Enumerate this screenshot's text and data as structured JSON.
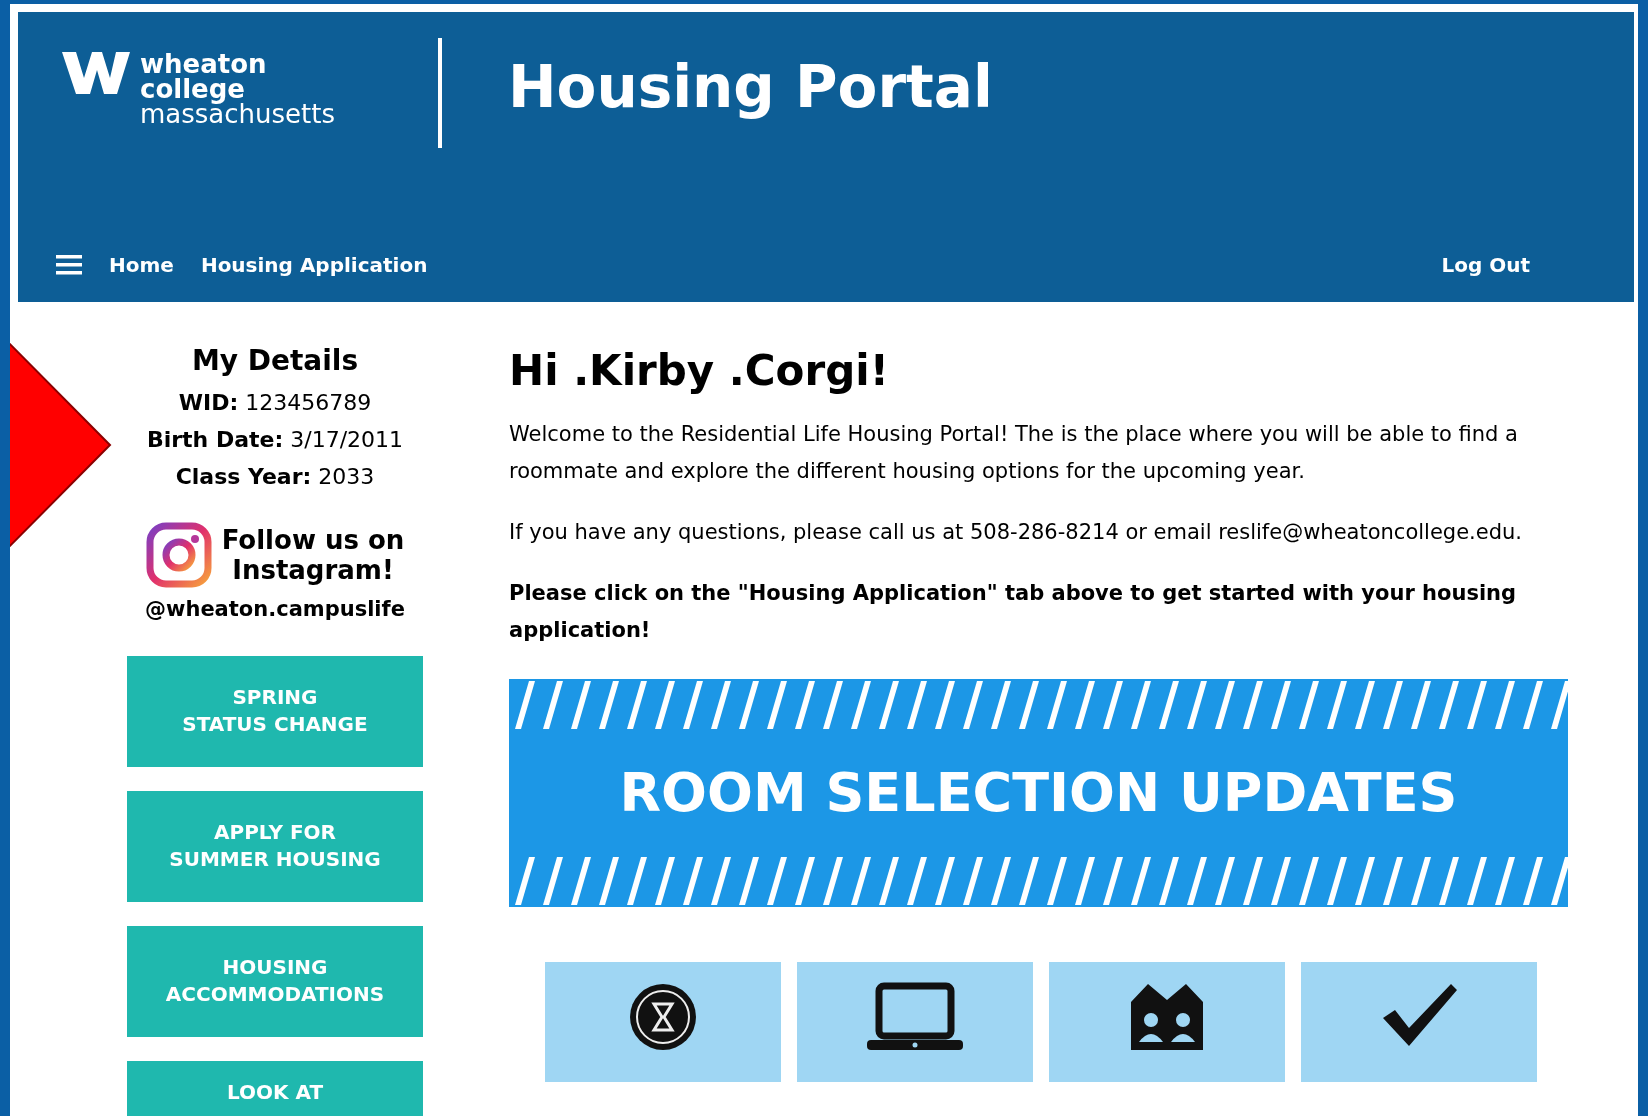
{
  "header": {
    "logo": [
      "wheaton",
      "college",
      "massachusetts"
    ],
    "title": "Housing Portal"
  },
  "nav": {
    "items": [
      {
        "label": "Home"
      },
      {
        "label": "Housing Application"
      }
    ],
    "logout": "Log Out"
  },
  "sidebar": {
    "heading": "My Details",
    "details": [
      {
        "label": "WID:",
        "value": "123456789"
      },
      {
        "label": "Birth Date:",
        "value": "3/17/2011"
      },
      {
        "label": "Class Year:",
        "value": "2033"
      }
    ],
    "instagram": {
      "lines": [
        "Follow us on",
        "Instagram!"
      ],
      "handle": "@wheaton.campuslife"
    },
    "buttons": [
      [
        "SPRING",
        "STATUS CHANGE"
      ],
      [
        "APPLY FOR",
        "SUMMER HOUSING"
      ],
      [
        "HOUSING",
        "ACCOMMODATIONS"
      ],
      [
        "LOOK AT"
      ]
    ]
  },
  "main": {
    "greeting": "Hi .Kirby .Corgi!",
    "paragraphs": [
      "Welcome to the Residential Life Housing Portal! The is the place where you will be able to find a roommate and explore the different housing options for the upcoming year.",
      "If you have any questions, please call us at 508-286-8214 or email reslife@wheatoncollege.edu."
    ],
    "callout": "Please click on the \"Housing Application\" tab above to get started with your housing application!",
    "banner": "ROOM SELECTION UPDATES",
    "tiles": [
      {
        "kind": "hourglass"
      },
      {
        "kind": "laptop"
      },
      {
        "kind": "people"
      },
      {
        "kind": "check"
      }
    ]
  }
}
